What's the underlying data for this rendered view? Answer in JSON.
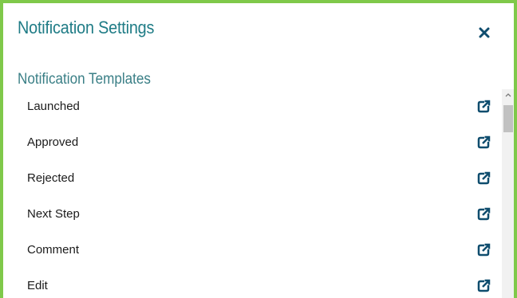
{
  "dialog": {
    "title": "Notification Settings",
    "close_icon": "close-icon"
  },
  "templates": {
    "section_title": "Notification Templates",
    "open_icon": "external-link-icon",
    "items": [
      {
        "label": "Launched"
      },
      {
        "label": "Approved"
      },
      {
        "label": "Rejected"
      },
      {
        "label": "Next Step"
      },
      {
        "label": "Comment"
      },
      {
        "label": "Edit"
      }
    ]
  },
  "colors": {
    "border": "#7fc94a",
    "title": "#1f7c86",
    "icon": "#0f4d6e"
  }
}
